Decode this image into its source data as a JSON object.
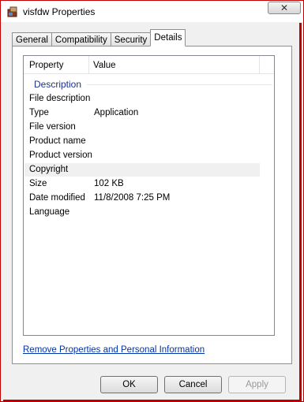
{
  "window": {
    "title": "visfdw Properties"
  },
  "tabs": [
    {
      "label": "General"
    },
    {
      "label": "Compatibility"
    },
    {
      "label": "Security"
    },
    {
      "label": "Details"
    }
  ],
  "active_tab": "Details",
  "table": {
    "headers": {
      "property": "Property",
      "value": "Value"
    },
    "group_label": "Description",
    "rows": [
      {
        "property": "File description",
        "value": ""
      },
      {
        "property": "Type",
        "value": "Application"
      },
      {
        "property": "File version",
        "value": ""
      },
      {
        "property": "Product name",
        "value": ""
      },
      {
        "property": "Product version",
        "value": ""
      },
      {
        "property": "Copyright",
        "value": ""
      },
      {
        "property": "Size",
        "value": "102 KB"
      },
      {
        "property": "Date modified",
        "value": "11/8/2008 7:25 PM"
      },
      {
        "property": "Language",
        "value": ""
      }
    ]
  },
  "link": {
    "label": "Remove Properties and Personal Information"
  },
  "buttons": {
    "ok": "OK",
    "cancel": "Cancel",
    "apply": "Apply"
  },
  "icons": {
    "title": "application-icon",
    "close": "close-icon"
  },
  "colors": {
    "frame_highlight": "#c00000",
    "group_label": "#1e3287",
    "link": "#0033aa"
  }
}
